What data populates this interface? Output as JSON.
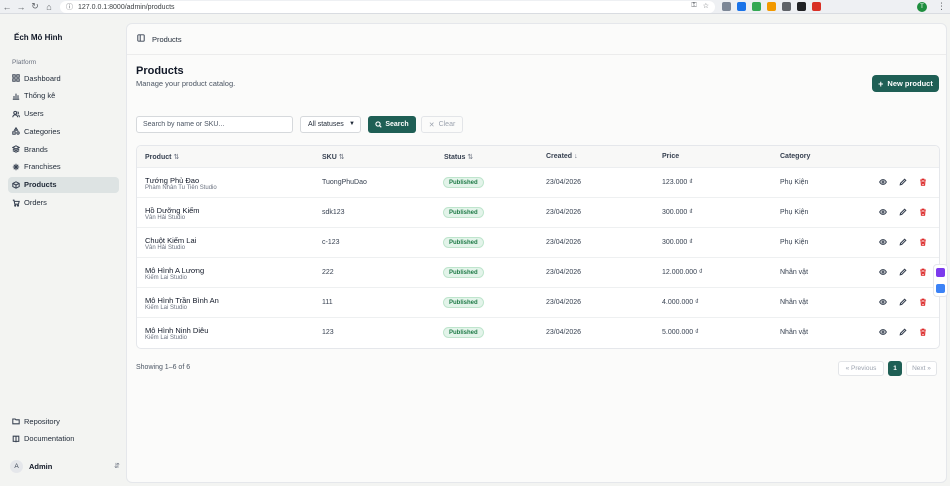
{
  "browser": {
    "url": "127.0.0.1:8000/admin/products"
  },
  "sidebar": {
    "brand": "Ếch Mô Hình",
    "section_label": "Platform",
    "items": [
      {
        "label": "Dashboard",
        "icon": "grid-icon",
        "active": false
      },
      {
        "label": "Thống kê",
        "icon": "bar-chart-icon",
        "active": false
      },
      {
        "label": "Users",
        "icon": "users-icon",
        "active": false
      },
      {
        "label": "Categories",
        "icon": "shapes-icon",
        "active": false
      },
      {
        "label": "Brands",
        "icon": "layers-icon",
        "active": false
      },
      {
        "label": "Franchises",
        "icon": "sparkle-icon",
        "active": false
      },
      {
        "label": "Products",
        "icon": "box-icon",
        "active": true
      },
      {
        "label": "Orders",
        "icon": "cart-icon",
        "active": false
      }
    ],
    "bottom_links": [
      {
        "label": "Repository",
        "icon": "folder-icon"
      },
      {
        "label": "Documentation",
        "icon": "book-icon"
      }
    ],
    "user": {
      "initial": "A",
      "name": "Admin"
    }
  },
  "header": {
    "breadcrumb": "Products"
  },
  "page": {
    "title": "Products",
    "subtitle": "Manage your product catalog.",
    "new_button": "New product"
  },
  "filters": {
    "search_placeholder": "Search by name or SKU...",
    "status_selected": "All statuses",
    "search_button": "Search",
    "clear_button": "Clear"
  },
  "table": {
    "columns": [
      "Product",
      "SKU",
      "Status",
      "Created",
      "Price",
      "Category"
    ],
    "rows": [
      {
        "name": "Tướng Phủ Đao",
        "brand": "Phàm Nhân Tu Tiên Studio",
        "sku": "TuongPhuDao",
        "status": "Published",
        "created": "23/04/2026",
        "price": "123.000 ₫",
        "category": "Phụ Kiện"
      },
      {
        "name": "Hồ Dưỡng Kiếm",
        "brand": "Vân Hải Studio",
        "sku": "sdk123",
        "status": "Published",
        "created": "23/04/2026",
        "price": "300.000 ₫",
        "category": "Phụ Kiện"
      },
      {
        "name": "Chuột Kiếm Lai",
        "brand": "Vân Hải Studio",
        "sku": "c-123",
        "status": "Published",
        "created": "23/04/2026",
        "price": "300.000 ₫",
        "category": "Phụ Kiện"
      },
      {
        "name": "Mô Hình A Lương",
        "brand": "Kiếm Lai Studio",
        "sku": "222",
        "status": "Published",
        "created": "23/04/2026",
        "price": "12.000.000 ₫",
        "category": "Nhân vật"
      },
      {
        "name": "Mô Hình Trần Bình An",
        "brand": "Kiếm Lai Studio",
        "sku": "111",
        "status": "Published",
        "created": "23/04/2026",
        "price": "4.000.000 ₫",
        "category": "Nhân vật"
      },
      {
        "name": "Mô Hình Ninh Diêu",
        "brand": "Kiếm Lai Studio",
        "sku": "123",
        "status": "Published",
        "created": "23/04/2026",
        "price": "5.000.000 ₫",
        "category": "Nhân vật"
      }
    ]
  },
  "footer": {
    "showing": "Showing 1–6 of 6",
    "prev": "« Previous",
    "current_page": "1",
    "next": "Next »"
  },
  "colors": {
    "accent": "#1f5f55",
    "published_badge": "#1d7a46",
    "delete": "#dc2626"
  }
}
